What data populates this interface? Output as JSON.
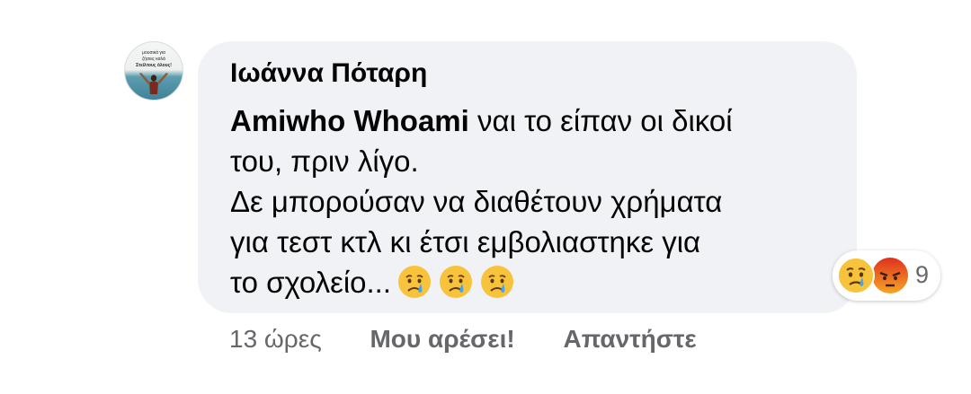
{
  "comment": {
    "author": "Ιωάννα Πόταρη",
    "avatar_caption": [
      "μουσικά για",
      "ζήσεις καλά",
      "Στείλτους όλους!"
    ],
    "mention": "Amiwho Whoami",
    "line1_rest": " ναι το είπαν οι δικοί",
    "line2": "του, πριν λίγο.",
    "line3": "Δε μπορούσαν να διαθέτουν χρήματα",
    "line4": "για τεστ κτλ κι έτσι εμβολιαστηκε για",
    "line5": "το σχολείο...",
    "emojis": [
      "crying-face",
      "crying-face",
      "crying-face"
    ]
  },
  "reactions": {
    "types": [
      "sad",
      "angry"
    ],
    "count": "9"
  },
  "actions": {
    "time": "13 ώρες",
    "like_label": "Μου αρέσει!",
    "reply_label": "Απαντήστε"
  },
  "colors": {
    "bubble_bg": "#f0f2f5",
    "text": "#050505",
    "secondary": "#65676b",
    "emoji_yellow": "#f7b125",
    "angry_red": "#e9710f"
  }
}
